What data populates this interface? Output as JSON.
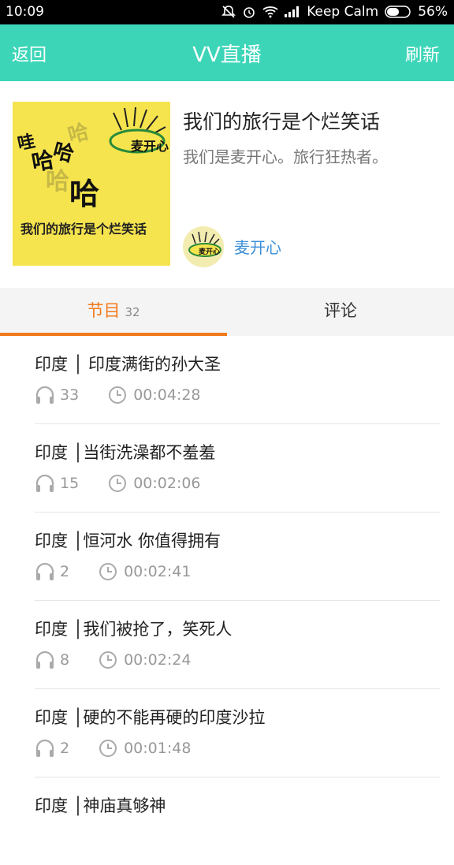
{
  "status": {
    "time": "10:09",
    "carrier": "Keep Calm",
    "battery": "56%",
    "battery_level": 0.56
  },
  "header": {
    "back_label": "返回",
    "title": "VV直播",
    "refresh_label": "刷新",
    "color": "#3dd5b8"
  },
  "album": {
    "title": "我们的旅行是个烂笑话",
    "description": "我们是麦开心。旅行狂热者。",
    "author": "麦开心",
    "cover": {
      "words": [
        "哇",
        "哈",
        "哈",
        "哈"
      ],
      "caption": "我们的旅行是个烂笑话",
      "logo_text": "麦开心",
      "logo_subtext": "My Happy Travelshopping"
    }
  },
  "tabs": [
    {
      "label": "节目",
      "count": "32",
      "active": true
    },
    {
      "label": "评论",
      "active": false
    }
  ],
  "accent_color": "#f27a1a",
  "programs": [
    {
      "title": "印度 │ 印度满街的孙大圣",
      "plays": "33",
      "duration": "00:04:28"
    },
    {
      "title": "印度 │当街洗澡都不羞羞",
      "plays": "15",
      "duration": "00:02:06"
    },
    {
      "title": "印度 │恒河水 你值得拥有",
      "plays": "2",
      "duration": "00:02:41"
    },
    {
      "title": "印度 │我们被抢了，笑死人",
      "plays": "8",
      "duration": "00:02:24"
    },
    {
      "title": "印度 │硬的不能再硬的印度沙拉",
      "plays": "2",
      "duration": "00:01:48"
    },
    {
      "title": "印度 │神庙真够神",
      "plays": "",
      "duration": ""
    }
  ]
}
